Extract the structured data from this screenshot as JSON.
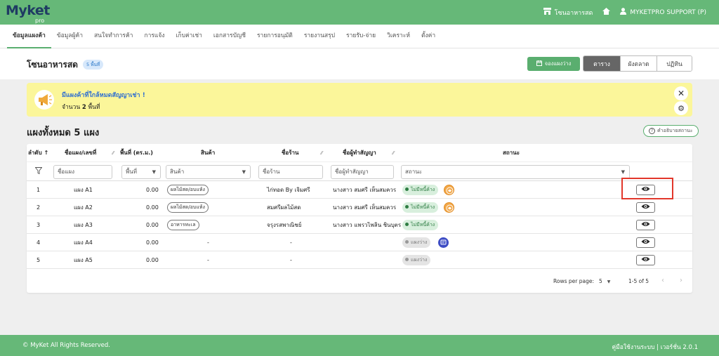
{
  "app": {
    "logo": "Myket",
    "logo_sub": "pro"
  },
  "topbar": {
    "market": "โซนอาหารสด",
    "user": "MYKETPRO SUPPORT (P)"
  },
  "nav": {
    "tabs": [
      "ข้อมูลแผงค้า",
      "ข้อมูลผู้ค้า",
      "สนใจทำการค้า",
      "การแจ้ง",
      "เก็บค่าเช่า",
      "เอกสารบัญชี",
      "รายการอนุมัติ",
      "รายงานสรุป",
      "รายรับ-จ่าย",
      "วิเคราะห์",
      "ตั้งค่า"
    ],
    "active": 0
  },
  "header": {
    "title": "โซนอาหารสด",
    "badge": "5 พื้นที่",
    "reserve_button": "จองแผงว่าง",
    "views": [
      "ตาราง",
      "ผังตลาด",
      "ปฏิทิน"
    ],
    "active_view": 0
  },
  "alert": {
    "title": "มีแผงค้าที่ใกล้หมดสัญญาเช่า !",
    "count_prefix": "จำนวน",
    "count": "2",
    "count_suffix": "พื้นที่"
  },
  "section": {
    "title": "แผงทั้งหมด 5 แผง",
    "status_help": "คำอธิบายสถานะ"
  },
  "table": {
    "headers": {
      "no": "ลำดับ",
      "name": "ชื่อแผง/เลขที่",
      "area": "พื้นที่ (ตร.ม.)",
      "product": "สินค้า",
      "shop": "ชื่อร้าน",
      "tenant": "ชื่อผู้ทำสัญญา",
      "status": "สถานะ"
    },
    "filters": {
      "name": "ชื่อแผง",
      "area": "พื้นที่",
      "product": "สินค้า",
      "shop": "ชื่อร้าน",
      "tenant": "ชื่อผู้ทำสัญญา",
      "status": "สถานะ"
    },
    "rows": [
      {
        "no": "1",
        "name": "แผง A1",
        "area": "0.00",
        "product": "ผลไม้สด/อบแห้ง",
        "shop": "ไก่ทอด By เจิมศรี",
        "tenant": "นางสาว สมศรี เห็นสมควร",
        "status": "ไม่มีหนี้ค้าง",
        "status_type": "ok",
        "badge": "orange"
      },
      {
        "no": "2",
        "name": "แผง A2",
        "area": "0.00",
        "product": "ผลไม้สด/อบแห้ง",
        "shop": "สมศรีผลไม้สด",
        "tenant": "นางสาว สมศรี เห็นสมควร",
        "status": "ไม่มีหนี้ค้าง",
        "status_type": "ok",
        "badge": "orange"
      },
      {
        "no": "3",
        "name": "แผง A3",
        "area": "0.00",
        "product": "อาหารทะเล",
        "shop": "จรุงรสพาณิชย์",
        "tenant": "นางสาว แพรวไพลิน ชินบุตร",
        "status": "ไม่มีหนี้ค้าง",
        "status_type": "ok",
        "badge": ""
      },
      {
        "no": "4",
        "name": "แผง A4",
        "area": "0.00",
        "product": "-",
        "shop": "-",
        "tenant": "",
        "status": "แผงว่าง",
        "status_type": "empty",
        "badge": "blue"
      },
      {
        "no": "5",
        "name": "แผง A5",
        "area": "0.00",
        "product": "-",
        "shop": "-",
        "tenant": "",
        "status": "แผงว่าง",
        "status_type": "empty",
        "badge": ""
      }
    ],
    "pager": {
      "rows_per_page_label": "Rows per page:",
      "rows_per_page": "5",
      "range": "1-5 of 5"
    }
  },
  "footer": {
    "copyright": "© MyKet All Rights Reserved.",
    "links": "คู่มือใช้งานระบบ | เวอร์ชั่น 2.0.1"
  },
  "colors": {
    "brand": "#66b878",
    "accent": "#5aae6f",
    "highlight": "#e2372b",
    "alert_bg": "#fbf69a"
  }
}
